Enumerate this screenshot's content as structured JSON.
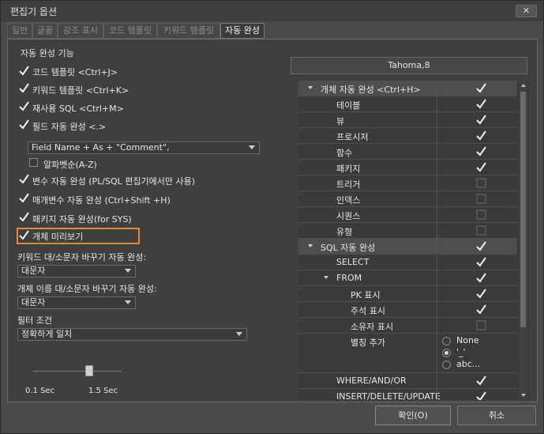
{
  "window": {
    "title": "편집기 옵션",
    "close_label": "✕"
  },
  "tabs": [
    {
      "label": "일반",
      "active": false
    },
    {
      "label": "글꼴",
      "active": false
    },
    {
      "label": "강조 표시",
      "active": false
    },
    {
      "label": "코드 템플릿",
      "active": false
    },
    {
      "label": "키워드 템플릿",
      "active": false
    },
    {
      "label": "자동 완성",
      "active": true
    }
  ],
  "autocomplete": {
    "group_title": "자동 완성 기능",
    "options": [
      {
        "label": "코드 템플릿 <Ctrl+J>",
        "checked": true
      },
      {
        "label": "키워드 템플릿 <Ctrl+K>",
        "checked": true
      },
      {
        "label": "재사용 SQL <Ctrl+M>",
        "checked": true
      },
      {
        "label": "필드 자동 완성 <.>",
        "checked": true
      }
    ],
    "field_format": "Field Name + As + \"Comment\",",
    "alphabetical": {
      "label": "알파벳순(A-Z)",
      "checked": false
    },
    "options2": [
      {
        "label": "변수 자동 완성 (PL/SQL 편집기에서만 사용)",
        "checked": true
      },
      {
        "label": "매개변수 자동 완성 (Ctrl+Shift +H)",
        "checked": true
      },
      {
        "label": "패키지 자동 완성(for SYS)",
        "checked": true
      },
      {
        "label": "개체 미리보기",
        "checked": true
      }
    ],
    "keyword_case_label": "키워드 대/소문자 바꾸기 자동 완성:",
    "keyword_case_value": "대문자",
    "object_case_label": "개체 이름 대/소문자 바꾸기 자동 완성:",
    "object_case_value": "대문자",
    "filter_label": "필터 조건",
    "filter_value": "정확하게 일치",
    "delay_min": "0.1 Sec",
    "delay_max": "1.5 Sec",
    "delay_fraction": 1.0
  },
  "font_button": "Tahoma,8",
  "tree": {
    "rows": [
      {
        "name": "개체 자동 완성 <Ctrl+H>",
        "level": 0,
        "section": true,
        "expanded": true,
        "checked": true
      },
      {
        "name": "테이블",
        "level": 1,
        "checked": true
      },
      {
        "name": "뷰",
        "level": 1,
        "checked": true
      },
      {
        "name": "프로시저",
        "level": 1,
        "checked": true
      },
      {
        "name": "함수",
        "level": 1,
        "checked": true
      },
      {
        "name": "패키지",
        "level": 1,
        "checked": true
      },
      {
        "name": "트리거",
        "level": 1,
        "checked": false
      },
      {
        "name": "인덱스",
        "level": 1,
        "checked": false
      },
      {
        "name": "시퀀스",
        "level": 1,
        "checked": false
      },
      {
        "name": "유형",
        "level": 1,
        "checked": false
      },
      {
        "name": "SQL 자동 완성",
        "level": 0,
        "section": true,
        "expanded": true,
        "checked": true
      },
      {
        "name": "SELECT",
        "level": 1,
        "checked": true
      },
      {
        "name": "FROM",
        "level": 1,
        "expanded": true,
        "checked": true
      },
      {
        "name": "PK 표시",
        "level": 2,
        "checked": true
      },
      {
        "name": "주석 표시",
        "level": 2,
        "checked": true
      },
      {
        "name": "소유자 표시",
        "level": 2,
        "checked": false
      },
      {
        "name": "별칭 추가",
        "level": 2,
        "radio": true
      },
      {
        "name": "WHERE/AND/OR",
        "level": 1,
        "checked": true
      },
      {
        "name": "INSERT/DELETE/UPDATE",
        "level": 1,
        "checked": true
      }
    ],
    "alias_options": [
      {
        "label": "None",
        "selected": false
      },
      {
        "label": "'_'",
        "selected": true
      },
      {
        "label": "abc...",
        "selected": false
      }
    ]
  },
  "buttons": {
    "ok": "확인(O)",
    "cancel": "취소"
  },
  "colors": {
    "accent": "#e8883a"
  }
}
